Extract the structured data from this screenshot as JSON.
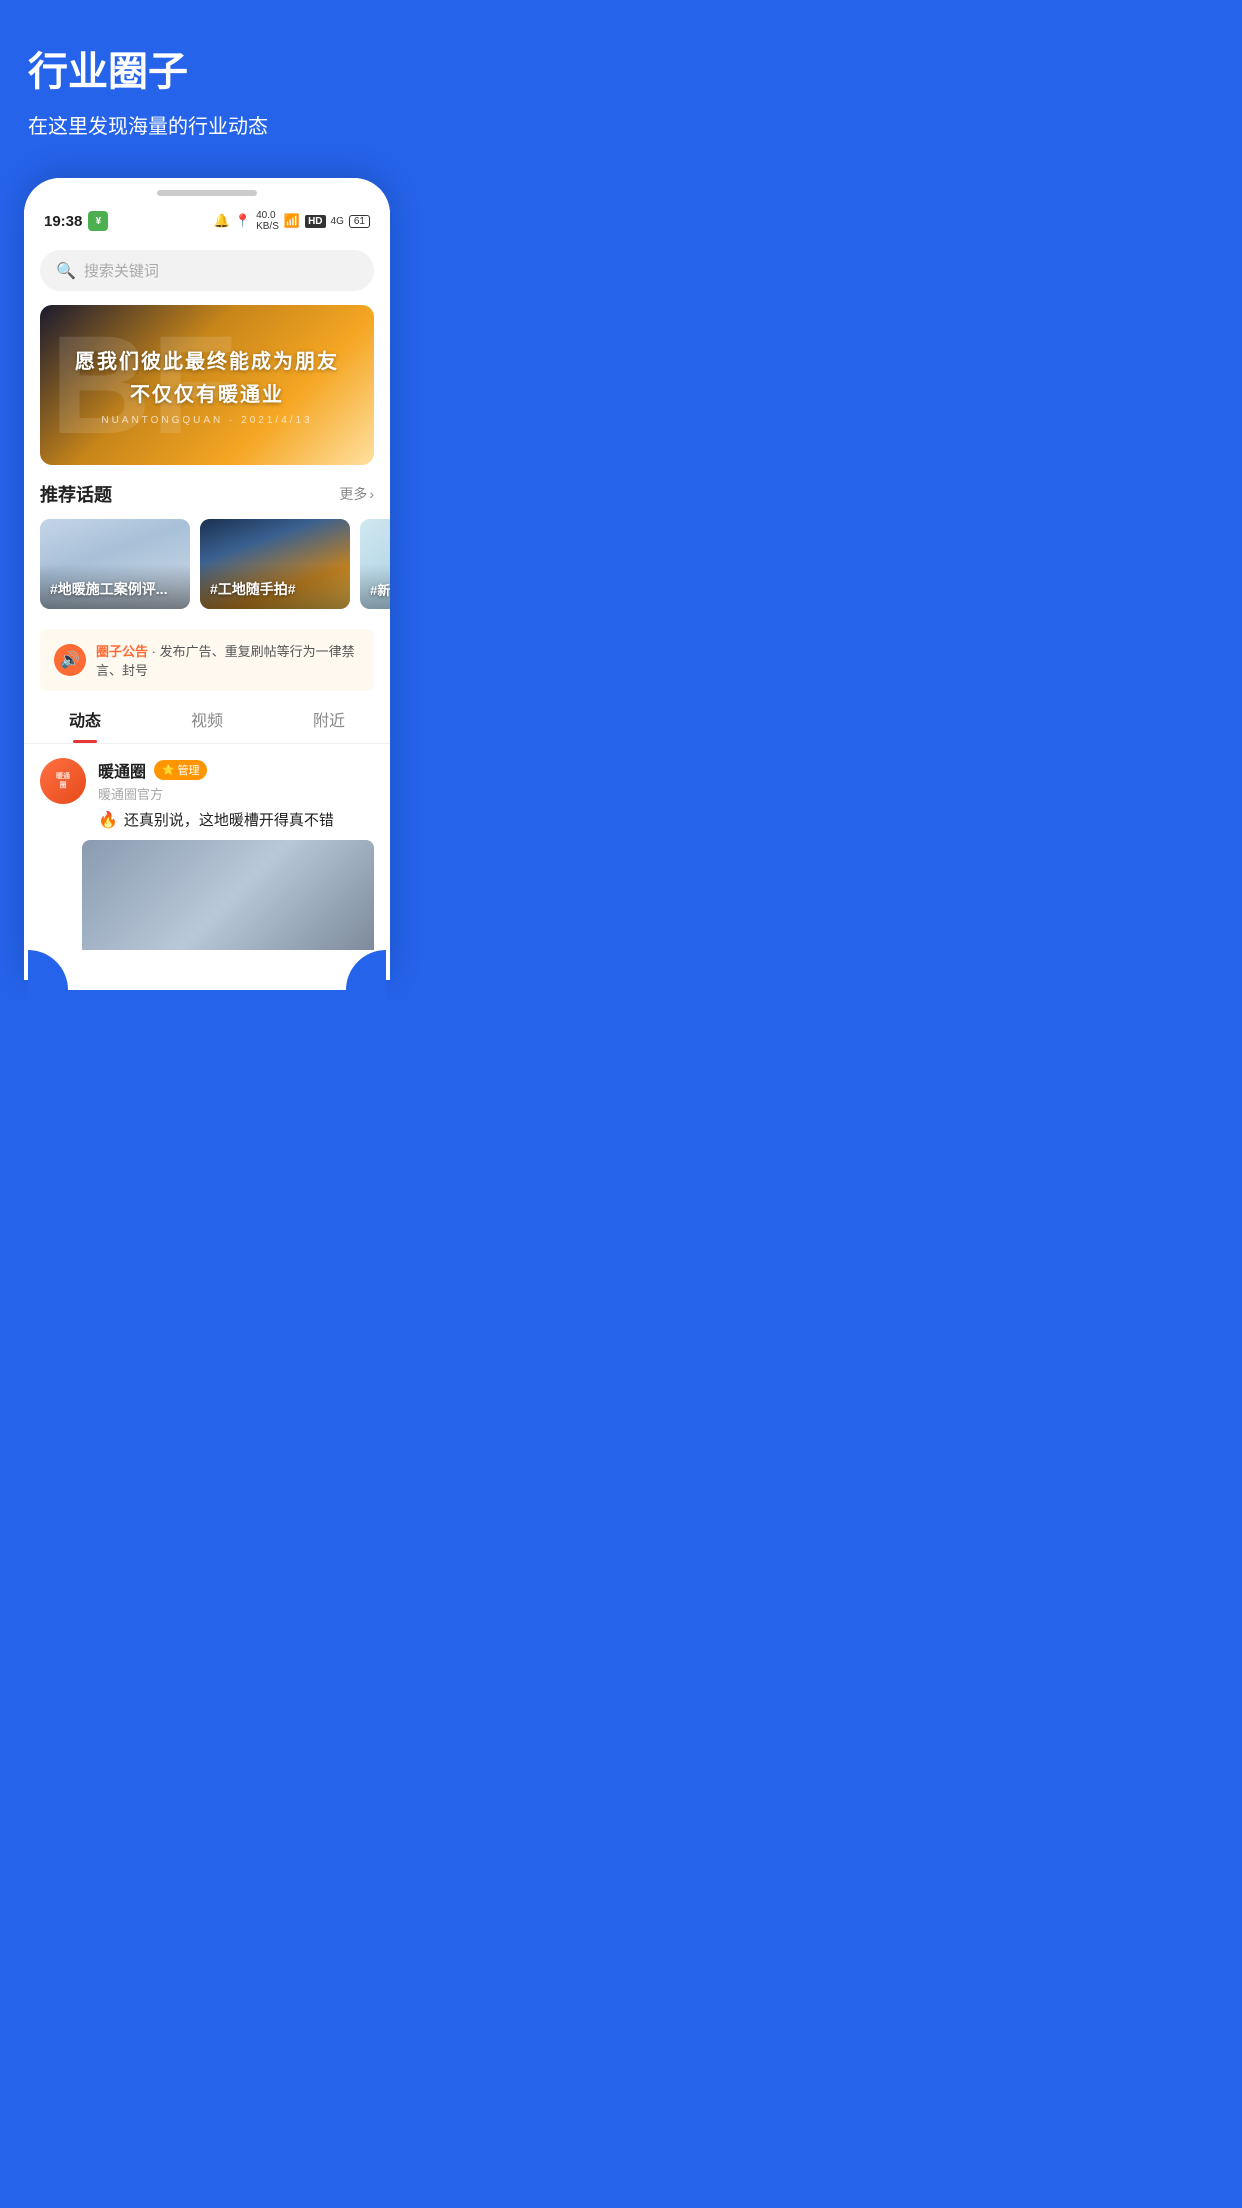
{
  "page": {
    "title": "行业圈子",
    "subtitle": "在这里发现海量的行业动态"
  },
  "statusBar": {
    "time": "19:38",
    "appIconLabel": "¥",
    "speedLabel": "40.0\nKB/S",
    "batteryLabel": "61"
  },
  "search": {
    "placeholder": "搜索关键词"
  },
  "banner": {
    "text1": "愿我们彼此最终能成为朋友",
    "text2": "不仅仅有暖通业",
    "sub": "NUANTONGQUAN · 2021/4/13"
  },
  "recommendedTopics": {
    "sectionTitle": "推荐话题",
    "moreLabel": "更多",
    "topics": [
      {
        "label": "#地暖施工案例评..."
      },
      {
        "label": "#工地随手拍#"
      },
      {
        "label": "#新..."
      }
    ]
  },
  "announcement": {
    "prefix": "圈子公告",
    "text": "· 发布广告、重复刷帖等行为一律禁言、封号"
  },
  "tabs": [
    {
      "label": "动态",
      "active": true
    },
    {
      "label": "视频",
      "active": false
    },
    {
      "label": "附近",
      "active": false
    }
  ],
  "post": {
    "username": "暖通圈",
    "badgeLabel": "管理",
    "subname": "暖通圈官方",
    "text": "还真别说，这地暖槽开得真不错"
  }
}
